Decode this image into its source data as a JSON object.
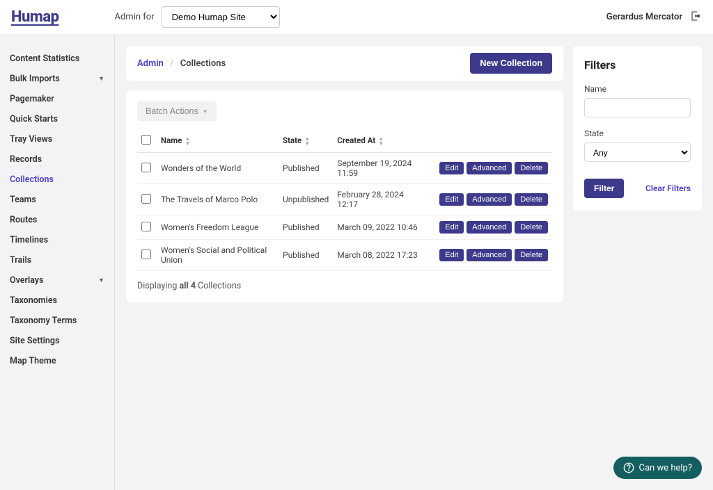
{
  "logo": "Humap",
  "admin_for_label": "Admin for",
  "site_selected": "Demo Humap Site",
  "user_name": "Gerardus Mercator",
  "sidebar": {
    "items": [
      {
        "label": "Content Statistics",
        "expandable": false
      },
      {
        "label": "Bulk Imports",
        "expandable": true
      },
      {
        "label": "Pagemaker",
        "expandable": false
      },
      {
        "label": "Quick Starts",
        "expandable": false
      },
      {
        "label": "Tray Views",
        "expandable": false
      },
      {
        "label": "Records",
        "expandable": false
      },
      {
        "label": "Collections",
        "expandable": false,
        "active": true
      },
      {
        "label": "Teams",
        "expandable": false
      },
      {
        "label": "Routes",
        "expandable": false
      },
      {
        "label": "Timelines",
        "expandable": false
      },
      {
        "label": "Trails",
        "expandable": false
      },
      {
        "label": "Overlays",
        "expandable": true
      },
      {
        "label": "Taxonomies",
        "expandable": false
      },
      {
        "label": "Taxonomy Terms",
        "expandable": false
      },
      {
        "label": "Site Settings",
        "expandable": false
      },
      {
        "label": "Map Theme",
        "expandable": false
      }
    ]
  },
  "breadcrumb": {
    "root": "Admin",
    "current": "Collections"
  },
  "new_button": "New Collection",
  "batch_actions": "Batch Actions",
  "columns": {
    "name": "Name",
    "state": "State",
    "created_at": "Created At"
  },
  "rows": [
    {
      "name": "Wonders of the World",
      "state": "Published",
      "created_at": "September 19, 2024 11:59"
    },
    {
      "name": "The Travels of Marco Polo",
      "state": "Unpublished",
      "created_at": "February 28, 2024 12:17"
    },
    {
      "name": "Women's Freedom League",
      "state": "Published",
      "created_at": "March 09, 2022 10:46"
    },
    {
      "name": "Women's Social and Political Union",
      "state": "Published",
      "created_at": "March 08, 2022 17:23"
    }
  ],
  "row_actions": {
    "edit": "Edit",
    "advanced": "Advanced",
    "delete": "Delete"
  },
  "displaying": {
    "prefix": "Displaying ",
    "bold": "all 4",
    "suffix": " Collections"
  },
  "filters": {
    "title": "Filters",
    "name_label": "Name",
    "state_label": "State",
    "state_value": "Any",
    "filter_btn": "Filter",
    "clear": "Clear Filters"
  },
  "help": "Can we help?"
}
